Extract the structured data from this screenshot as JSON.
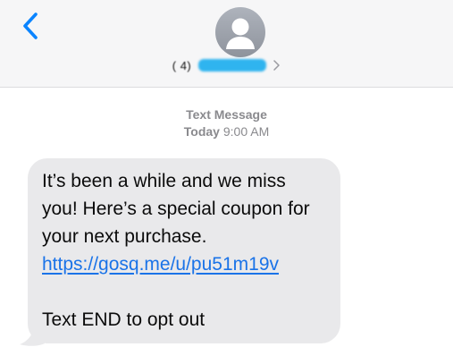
{
  "header": {
    "back_icon": "chevron-left-icon",
    "avatar_icon": "person-silhouette-icon",
    "contact_number_partial": "(   4)",
    "contact_chevron_icon": "chevron-right-icon",
    "accent_color": "#0a84ff"
  },
  "thread": {
    "message_type": "Text Message",
    "day": "Today",
    "time": "9:00 AM"
  },
  "message": {
    "line1": "It’s been a while and we miss",
    "line2": "you! Here’s a special coupon for",
    "line3": "your next purchase.",
    "link": "https://gosq.me/u/pu51m19v",
    "opt_out": "Text END to opt out",
    "bubble_color": "#e9e9eb",
    "link_color": "#1a73e8"
  }
}
